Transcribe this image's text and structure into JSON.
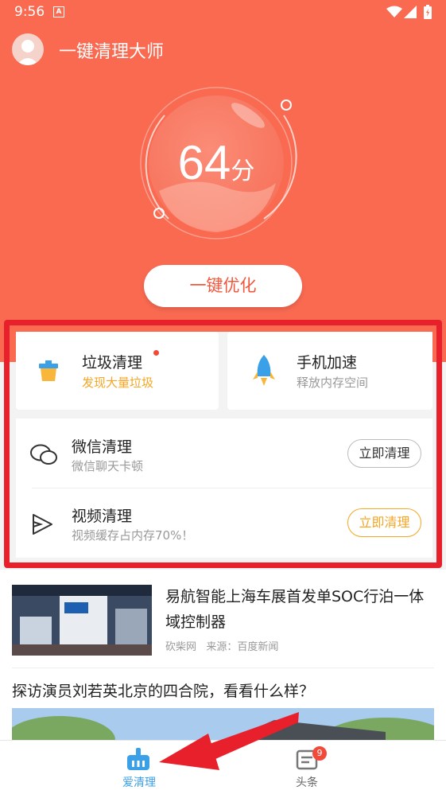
{
  "status_bar": {
    "time": "9:56",
    "notif_icon": "A"
  },
  "header": {
    "app_title": "一键清理大师"
  },
  "score": {
    "value": "64",
    "unit": "分"
  },
  "optimize_button": "一键优化",
  "cards": {
    "junk": {
      "title": "垃圾清理",
      "subtitle": "发现大量垃圾",
      "subtitle_color": "#f5a623"
    },
    "speed": {
      "title": "手机加速",
      "subtitle": "释放内存空间"
    }
  },
  "clean_list": [
    {
      "title": "微信清理",
      "subtitle": "微信聊天卡顿",
      "button": "立即清理"
    },
    {
      "title": "视频清理",
      "subtitle": "视频缓存占内存70%！",
      "button": "立即清理"
    }
  ],
  "feed": {
    "news1": {
      "title": "易航智能上海车展首发单SOC行泊一体域控制器",
      "source": "砍柴网",
      "origin": "来源：百度新闻"
    },
    "news2": {
      "title": "探访演员刘若英北京的四合院，看看什么样？"
    }
  },
  "tabbar": {
    "tabs": [
      {
        "label": "爱清理",
        "active": true
      },
      {
        "label": "头条",
        "badge": "9"
      }
    ]
  },
  "colors": {
    "hero": "#f96a51",
    "accent_orange": "#f5a623",
    "highlight_red": "#e8202b",
    "tab_active": "#3aa0e8"
  }
}
